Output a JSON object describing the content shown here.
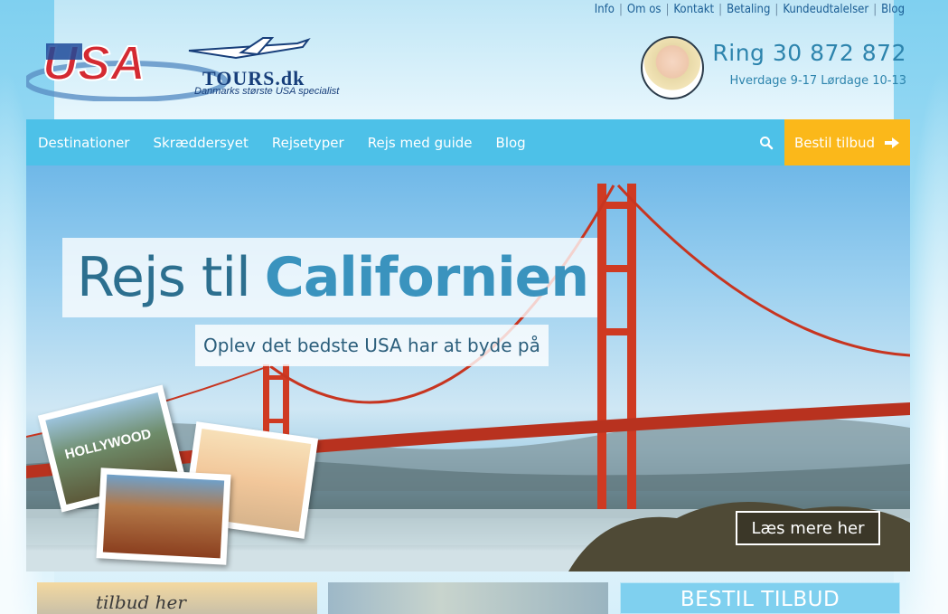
{
  "toplinks": [
    "Info",
    "Om os",
    "Kontakt",
    "Betaling",
    "Kundeudtalelser",
    "Blog"
  ],
  "logo": {
    "brand": "USA",
    "domain": "TOURS.dk",
    "tagline": "Danmarks største USA specialist"
  },
  "contact": {
    "phone": "Ring 30 872 872",
    "hours": "Hverdage 9-17 Lørdage 10-13"
  },
  "nav": {
    "items": [
      "Destinationer",
      "Skræddersyet",
      "Rejsetyper",
      "Rejs med guide",
      "Blog"
    ],
    "search_icon": "search-icon",
    "cta": "Bestil tilbud",
    "cta_icon": "arrow-right-icon"
  },
  "hero": {
    "title_prefix": "Rejs til",
    "title_highlight": "Californien",
    "subtitle": "Oplev det bedste USA har at byde på",
    "button": "Læs mere her",
    "photo_sign": "HOLLYWOOD"
  },
  "bottom": {
    "card1_text": "tilbud her",
    "card3_title": "BESTIL TILBUD"
  },
  "colors": {
    "nav": "#4dc1e8",
    "cta": "#fbb81a",
    "text_blue": "#2d84ad"
  }
}
